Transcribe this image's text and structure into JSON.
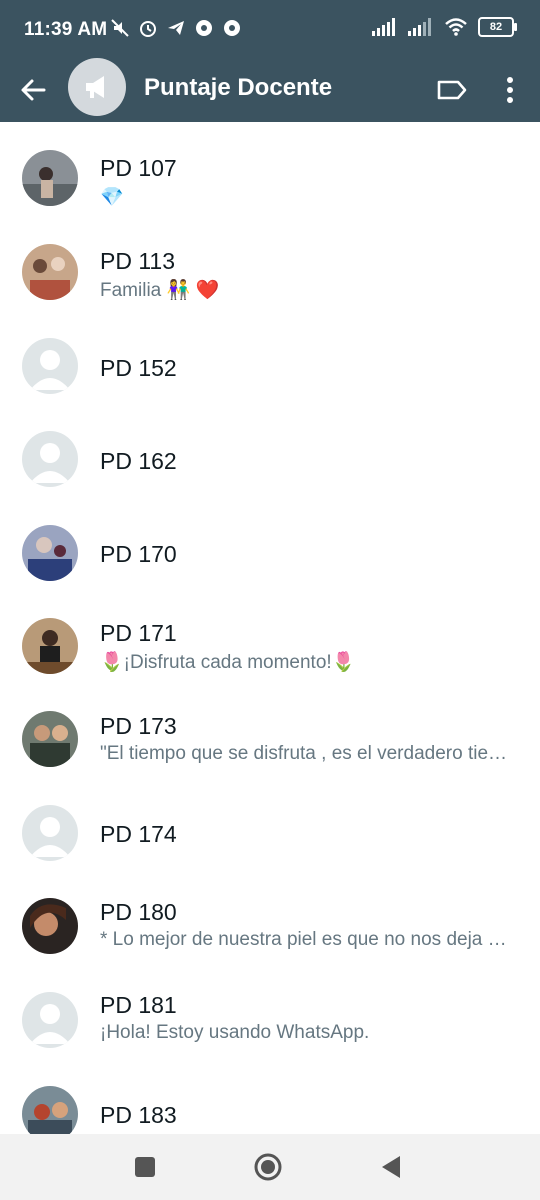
{
  "status_bar": {
    "time": "11:39 AM",
    "battery": "82",
    "icons": [
      "mute-icon",
      "alarm-icon",
      "telegram-icon",
      "chrome-icon",
      "chrome-icon",
      "signal-icon",
      "signal-icon",
      "wifi-icon",
      "battery-icon"
    ]
  },
  "app_bar": {
    "title": "Puntaje Docente",
    "back_icon": "arrow-left-icon",
    "avatar_icon": "megaphone-icon",
    "label_icon": "label-tag-icon",
    "menu_icon": "more-vertical-icon",
    "bg_color": "#3b5360"
  },
  "contacts": [
    {
      "name": "PD 107",
      "status": "💎"
    },
    {
      "name": "PD 113",
      "status": "Familia 👫 ❤️"
    },
    {
      "name": "PD 152",
      "status": ""
    },
    {
      "name": "PD 162",
      "status": ""
    },
    {
      "name": "PD 170",
      "status": ""
    },
    {
      "name": "PD 171",
      "status": "🌷¡Disfruta cada momento!🌷"
    },
    {
      "name": "PD 173",
      "status": "\"El tiempo que se disfruta , es el verdadero tiempo vivido\""
    },
    {
      "name": "PD 174",
      "status": ""
    },
    {
      "name": "PD 180",
      "status": "* Lo mejor de nuestra piel es que no nos deja ver lo que hay por dentro"
    },
    {
      "name": "PD 181",
      "status": "¡Hola! Estoy usando WhatsApp."
    },
    {
      "name": "PD 183",
      "status": ""
    }
  ],
  "nav_bar": {
    "icons": [
      "recents-square-icon",
      "home-circle-icon",
      "back-triangle-icon"
    ]
  }
}
